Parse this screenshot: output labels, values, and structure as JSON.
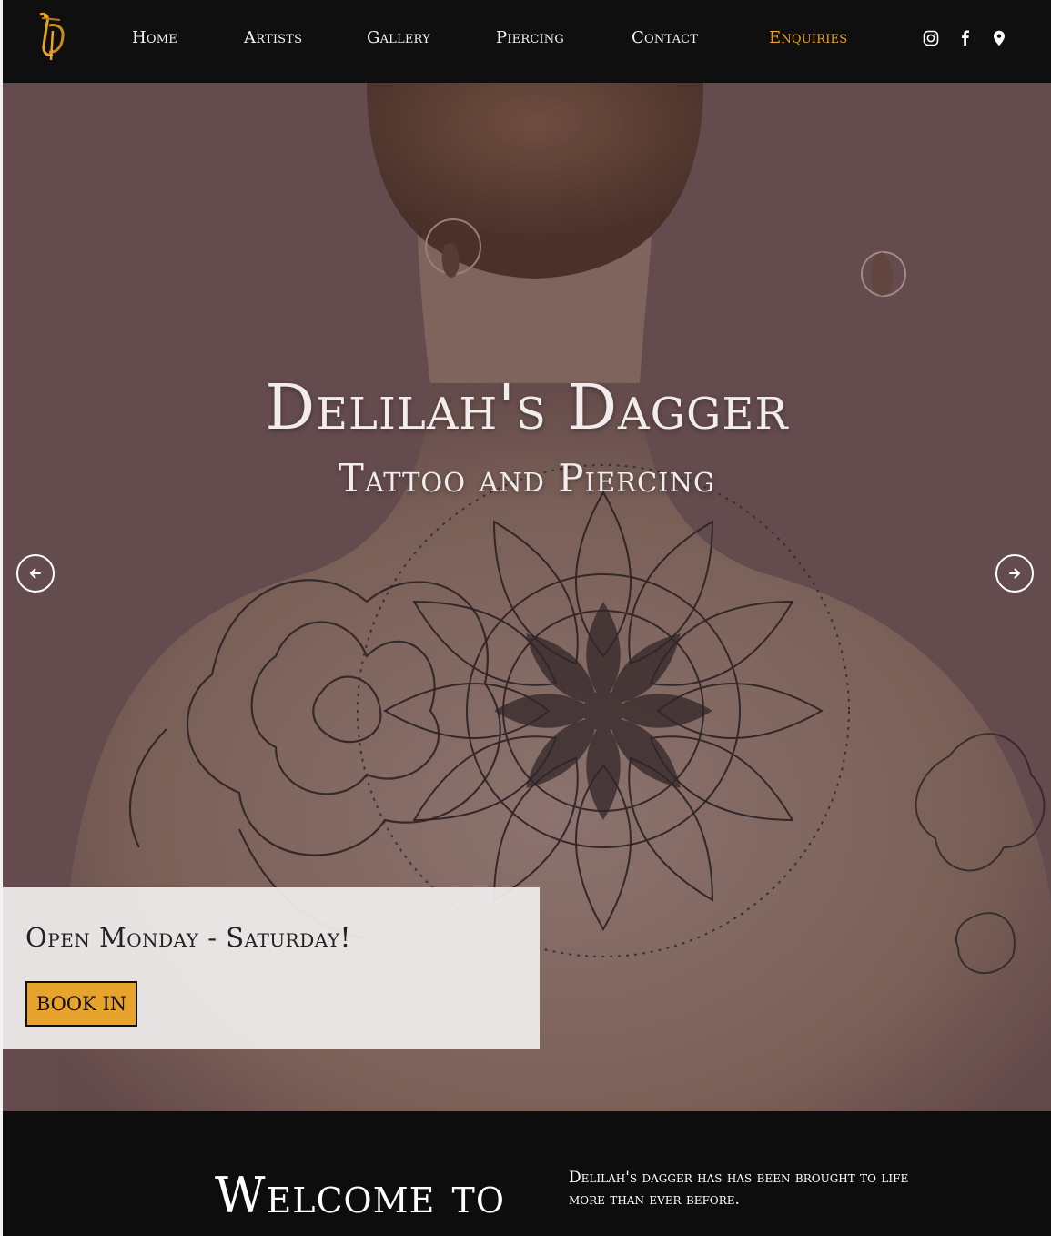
{
  "brand": {
    "logo_icon": "dd-monogram-logo",
    "accent": "#e8a32c"
  },
  "nav": {
    "items": [
      {
        "label": "Home"
      },
      {
        "label": "Artists"
      },
      {
        "label": "Gallery"
      },
      {
        "label": "Piercing"
      },
      {
        "label": "Contact"
      },
      {
        "label": "Enquiries",
        "active": true
      }
    ],
    "social": [
      {
        "icon": "instagram-icon"
      },
      {
        "icon": "facebook-icon"
      },
      {
        "icon": "map-pin-icon"
      }
    ]
  },
  "hero": {
    "title": "Delilah's Dagger",
    "subtitle": "Tattoo and Piercing",
    "prev_icon": "arrow-left-icon",
    "next_icon": "arrow-right-icon",
    "info": {
      "text": "Open Monday - Saturday!",
      "button_label": "BOOK IN"
    }
  },
  "welcome": {
    "title": "Welcome to",
    "text": "Delilah's dagger has has been brought to life more than ever before."
  }
}
